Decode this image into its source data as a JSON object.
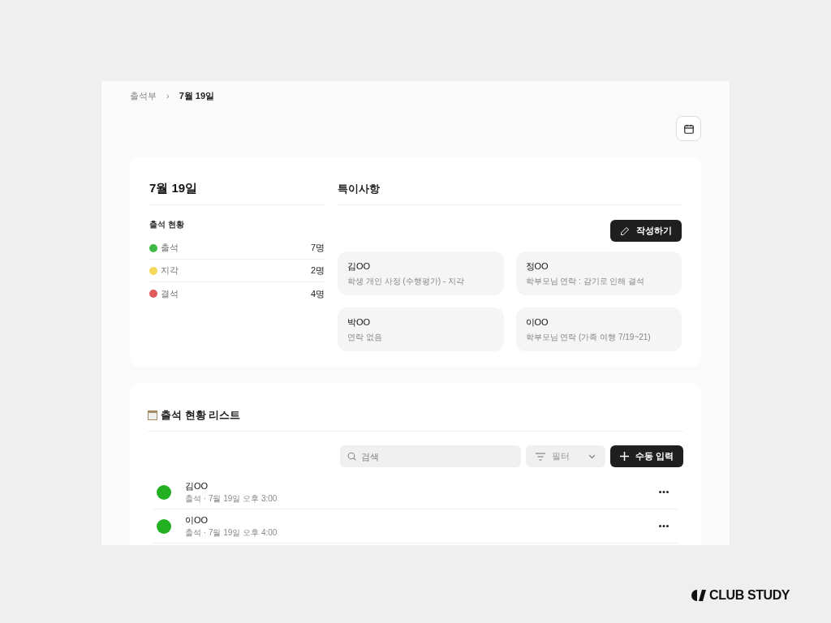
{
  "breadcrumb": [
    {
      "label": "출석부",
      "current": false
    },
    {
      "label": "›",
      "current": false
    },
    {
      "label": "7월 19일",
      "current": true
    }
  ],
  "summary": {
    "date": "7월 19일",
    "section_label": "출석 현황",
    "items": [
      {
        "label": "출석",
        "count": "7명",
        "color": "#3fb944"
      },
      {
        "label": "지각",
        "count": "2명",
        "color": "#f5d75a"
      },
      {
        "label": "결석",
        "count": "4명",
        "color": "#e05a5a"
      }
    ]
  },
  "notes": {
    "title": "특이사항",
    "write_button": "작성하기",
    "cards": [
      {
        "name": "김OO",
        "text": "학생 개인 사정 (수행평가) - 지각"
      },
      {
        "name": "정OO",
        "text": "학부모님 연락 : 감기로 인해 결석"
      },
      {
        "name": "박OO",
        "text": "연락 없음"
      },
      {
        "name": "이OO",
        "text": "학부모님 연락 (가족 여행 7/19~21)"
      }
    ]
  },
  "list": {
    "title": "출석 현황 리스트",
    "search": {
      "placeholder": "검색"
    },
    "filter": "필터",
    "add_button": "수동 입력",
    "rows": [
      {
        "name": "김OO",
        "detail": "출석 · 7월 19일 오후 3:00",
        "color": "#22b022"
      },
      {
        "name": "이OO",
        "detail": "출석 · 7월 19일 오후 4:00",
        "color": "#22b022"
      }
    ]
  },
  "brand": "CLUB STUDY"
}
